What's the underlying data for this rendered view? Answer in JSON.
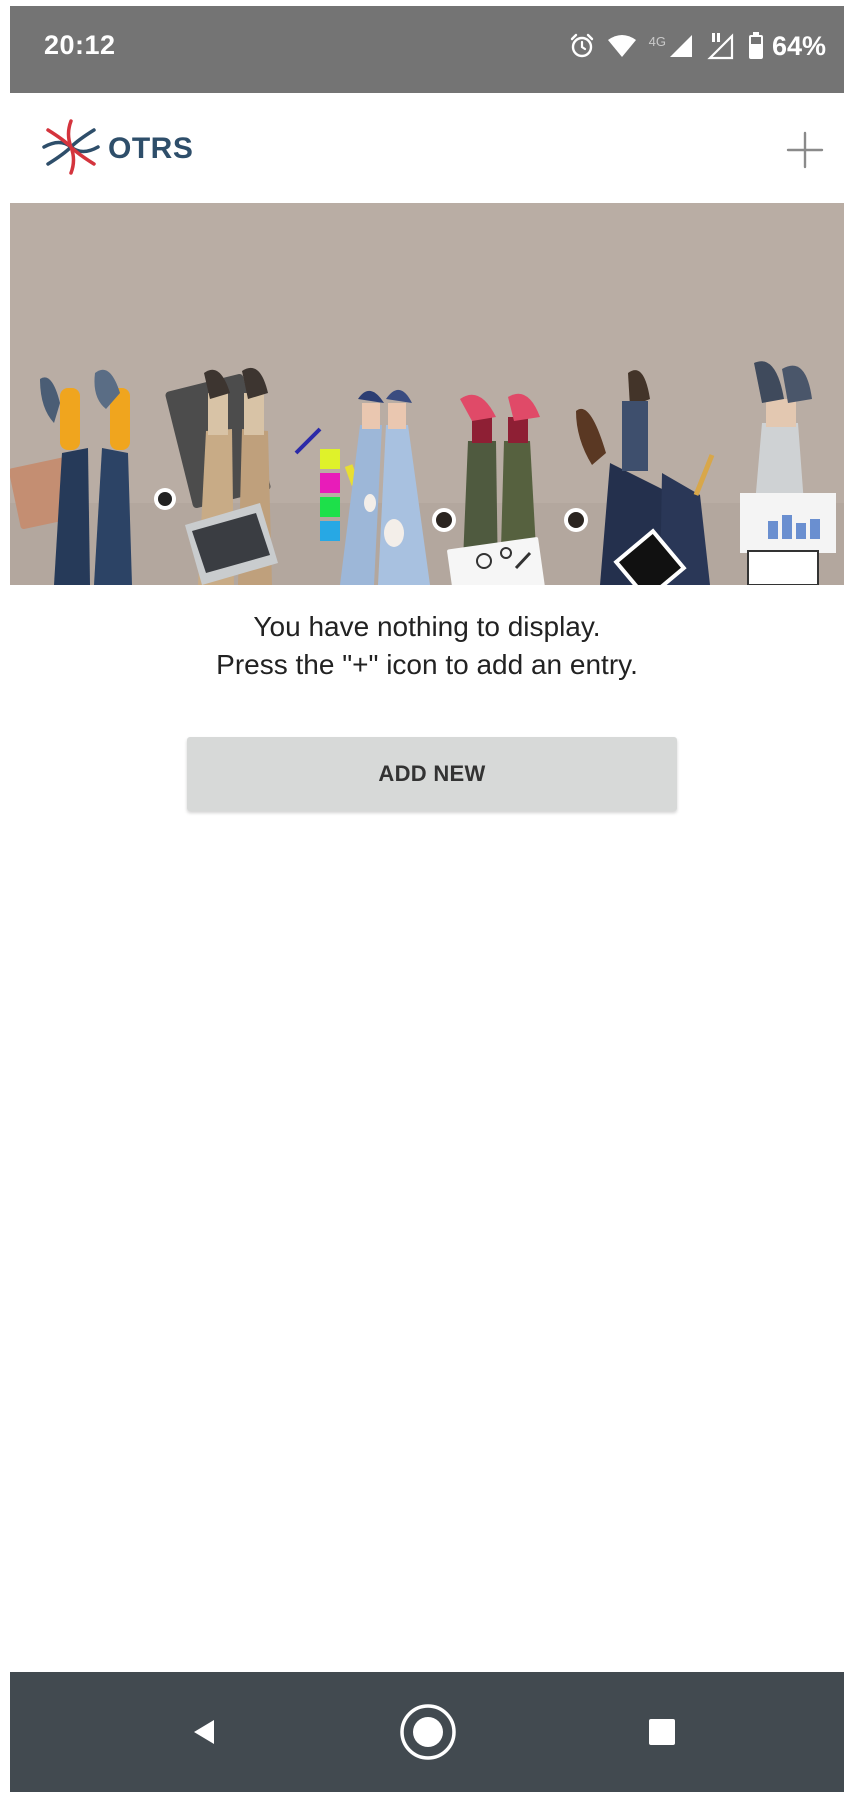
{
  "status_bar": {
    "time": "20:12",
    "network_label": "4G",
    "battery_percent": "64%",
    "icons": [
      "alarm-icon",
      "wifi-icon",
      "signal-icon",
      "signal-noroaming-icon",
      "battery-icon"
    ]
  },
  "app_bar": {
    "logo_text": "OTRS",
    "add_icon": "plus-icon"
  },
  "empty_state": {
    "line1": "You have nothing to display.",
    "line2": "Press the \"+\" icon to add an entry.",
    "button_label": "ADD NEW"
  },
  "nav_bar": {
    "icons": [
      "back-icon",
      "home-icon",
      "recents-icon"
    ]
  },
  "colors": {
    "status_bar": "#747474",
    "hero_background": "#b9ada4",
    "button_background": "#d7d9d8",
    "nav_bar": "#424a50",
    "logo_text": "#2e4e6a"
  }
}
